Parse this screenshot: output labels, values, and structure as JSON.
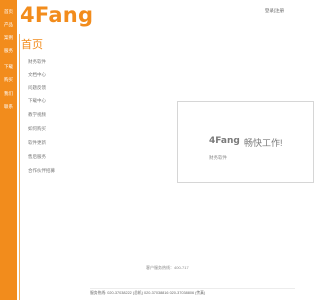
{
  "brand": {
    "logo_text": "4Fang"
  },
  "header": {
    "top_link": "登录|注册"
  },
  "left_nav": {
    "items": [
      {
        "label": "首页"
      },
      {
        "label": "产品"
      },
      {
        "label": "案例"
      },
      {
        "label": "服务"
      },
      {
        "label": "下载"
      },
      {
        "label": "购买"
      },
      {
        "label": "我们"
      },
      {
        "label": "联系"
      }
    ]
  },
  "sidebar": {
    "title": "首页",
    "items": [
      {
        "label": "财务软件"
      },
      {
        "label": "文档中心"
      },
      {
        "label": "问题反馈"
      },
      {
        "label": "下载中心"
      },
      {
        "label": "教学视频"
      },
      {
        "label": "如何购买"
      },
      {
        "label": "软件更新"
      },
      {
        "label": "售后服务"
      },
      {
        "label": "合作伙伴招募"
      }
    ]
  },
  "hero": {
    "brand": "4Fang",
    "slogan": "畅快工作!",
    "subtitle": "财务软件"
  },
  "hotline": "客户服务热线：400-717",
  "footer": {
    "text": "服务热线: 020-37038222 (总机) 020-37038816 020-37038806 (传真)"
  },
  "colors": {
    "accent": "#f28c1c",
    "background": "#ffffff"
  }
}
